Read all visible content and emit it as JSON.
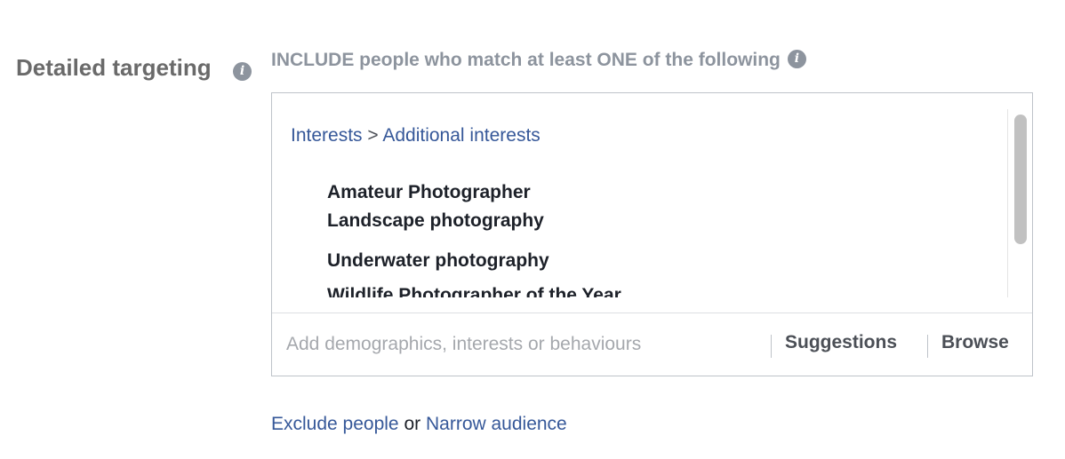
{
  "section": {
    "label": "Detailed targeting",
    "info_icon": "info-icon"
  },
  "include": {
    "text": "INCLUDE people who match at least ONE of the following",
    "info_icon": "info-icon"
  },
  "breadcrumb": {
    "category": "Interests",
    "separator": ">",
    "subcategory": "Additional interests"
  },
  "interests": [
    "Amateur Photographer",
    "Landscape photography",
    "Underwater photography",
    "Wildlife Photographer of the Year"
  ],
  "search": {
    "placeholder": "Add demographics, interests or behaviours",
    "value": ""
  },
  "actions": {
    "suggestions": "Suggestions",
    "browse": "Browse"
  },
  "footer": {
    "exclude": "Exclude people",
    "or": "or",
    "narrow": "Narrow audience"
  },
  "colors": {
    "link": "#365899",
    "label": "#6a6a6a",
    "muted": "#8d949e",
    "border": "#bec3c9"
  }
}
